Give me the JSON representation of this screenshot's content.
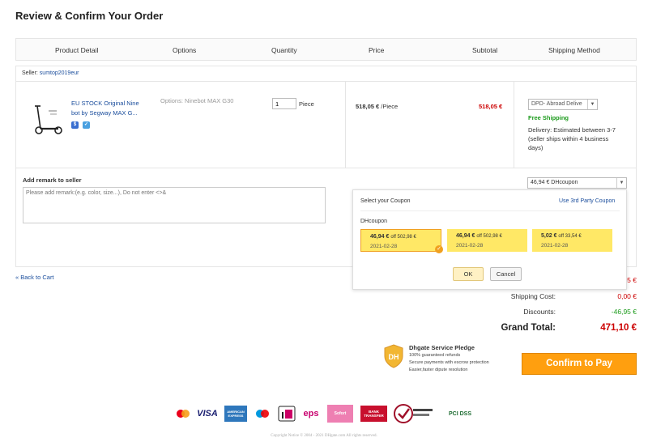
{
  "page": {
    "title": "Review & Confirm Your Order"
  },
  "table_headers": [
    "Product Detail",
    "Options",
    "Quantity",
    "Price",
    "Subtotal",
    "Shipping Method"
  ],
  "seller": {
    "label": "Seller:",
    "name": "sumtop2019eur"
  },
  "item": {
    "title": "EU STOCK Original Nine bot by Segway MAX G...",
    "options_label": "Options:",
    "options_value": "Ninebot MAX G30",
    "quantity": "1",
    "unit": "Piece",
    "price": "518,05 €",
    "price_unit": "/Piece",
    "subtotal": "518,05 €",
    "shipping_method": "DPD- Abroad Delive",
    "free_shipping": "Free Shipping",
    "delivery": "Delivery: Estimated between 3-7 (seller ships within 4 business days)"
  },
  "remark": {
    "label": "Add remark to seller",
    "placeholder": "Please add remark:(e.g. color, size...), Do not enter <>&"
  },
  "coupon_select": {
    "value": "46,94 € DHcoupon"
  },
  "coupon_popup": {
    "title": "Select your Coupon",
    "third_party": "Use 3rd Party Coupon",
    "category": "DHcoupon",
    "coupons": [
      {
        "amount": "46,94 €",
        "condition": "off 502,98 €",
        "date": "2021-02-28",
        "selected": true
      },
      {
        "amount": "46,94 €",
        "condition": "off 502,98 €",
        "date": "2021-02-28",
        "selected": false
      },
      {
        "amount": "5,02 €",
        "condition": "off 33,54 €",
        "date": "2021-02-28",
        "selected": false
      }
    ],
    "ok": "OK",
    "cancel": "Cancel"
  },
  "back_to_cart": "« Back to Cart",
  "summary": {
    "partial_value": "5 €",
    "shipping_label": "Shipping Cost:",
    "shipping_value": "0,00 €",
    "discounts_label": "Discounts:",
    "discounts_value": "-46,95 €",
    "grand_label": "Grand Total:",
    "grand_value": "471,10 €"
  },
  "pledge": {
    "title": "Dhgate Service Pledge",
    "lines": [
      "100% guaranteed refunds",
      "Secure payments with escrow protection",
      "Easier,faster dipute resolution"
    ]
  },
  "pay_button": "Confirm to Pay",
  "payment_logos": [
    "VISA",
    "AMERICAN EXPRESS",
    "eps",
    "Sofort",
    "BANK TRANSFER",
    "PCI DSS"
  ],
  "copyright": "Copyright Notice © 2004 - 2021 DHgate.com All rights reserved.",
  "colors": {
    "accent": "#ff9f0f",
    "price_red": "#c00000",
    "link_blue": "#1a4d9c",
    "green": "#1a9a1a",
    "coupon_yellow": "#ffe866"
  }
}
